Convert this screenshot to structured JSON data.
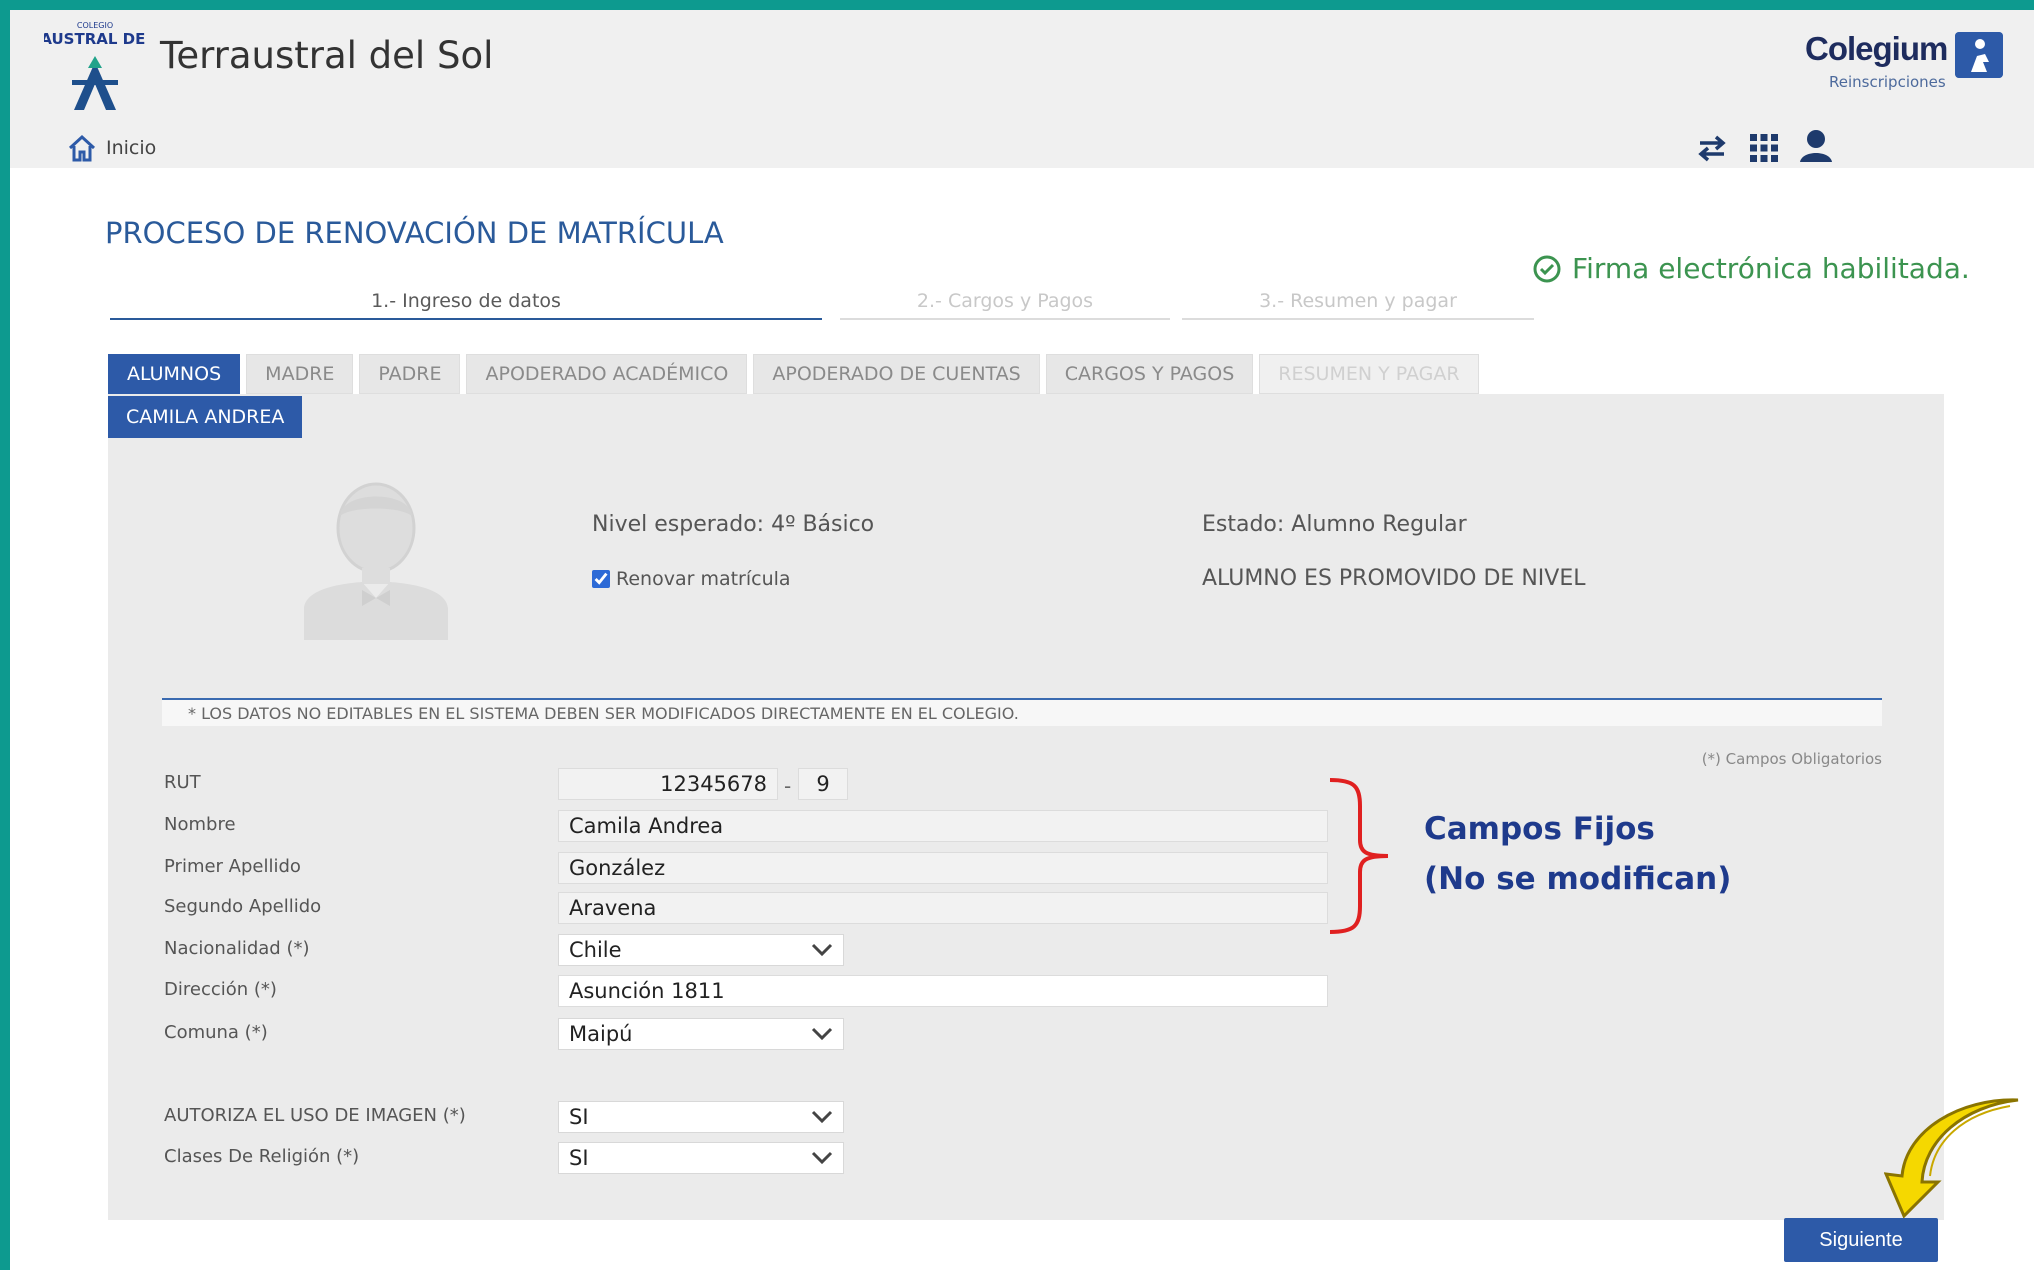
{
  "header": {
    "logo_text": "TERRAUSTRAL DEL SOL",
    "school_name": "Terraustral del Sol",
    "brand_name": "Colegium",
    "brand_sub": "Reinscripciones",
    "home_label": "Inicio"
  },
  "page": {
    "title": "PROCESO DE RENOVACIÓN DE MATRÍCULA",
    "firma": "Firma electrónica habilitada.",
    "steps": [
      "1.- Ingreso de datos",
      "2.- Cargos y Pagos",
      "3.- Resumen y pagar"
    ]
  },
  "tabs": [
    "ALUMNOS",
    "MADRE",
    "PADRE",
    "APODERADO ACADÉMICO",
    "APODERADO DE CUENTAS",
    "CARGOS Y PAGOS",
    "RESUMEN Y PAGAR"
  ],
  "student": {
    "tab": "CAMILA ANDREA",
    "nivel": "Nivel esperado: 4º Básico",
    "estado": "Estado: Alumno Regular",
    "renovar_label": "Renovar matrícula",
    "promovido": "ALUMNO ES PROMOVIDO DE NIVEL"
  },
  "form": {
    "note": "* LOS DATOS NO EDITABLES EN EL SISTEMA DEBEN SER MODIFICADOS DIRECTAMENTE EN EL COLEGIO.",
    "obligatorios": "(*) Campos Obligatorios",
    "rut_label": "RUT",
    "rut_number": "12345678",
    "rut_dash": "-",
    "rut_dv": "9",
    "nombre_label": "Nombre",
    "nombre": "Camila Andrea",
    "apellido1_label": "Primer Apellido",
    "apellido1": "González",
    "apellido2_label": "Segundo Apellido",
    "apellido2": "Aravena",
    "nacionalidad_label": "Nacionalidad (*)",
    "nacionalidad": "Chile",
    "direccion_label": "Dirección (*)",
    "direccion": "Asunción 1811",
    "comuna_label": "Comuna (*)",
    "comuna": "Maipú",
    "imagen_label": "AUTORIZA EL USO DE IMAGEN (*)",
    "imagen": "SI",
    "religion_label": "Clases De Religión (*)",
    "religion": "SI"
  },
  "annotation": {
    "line1": "Campos Fijos",
    "line2": "(No se modifican)"
  },
  "next_label": "Siguiente",
  "colors": {
    "teal_border": "#0d9a8f",
    "primary_blue": "#2d5aa8",
    "brace_red": "#e02020",
    "annotation_blue": "#1e3a8c",
    "arrow_yellow": "#f5d800",
    "firma_green": "#3c9450"
  },
  "icons": [
    "home-icon",
    "switch-icon",
    "apps-grid-icon",
    "user-icon",
    "check-circle-icon",
    "chevron-down-icon",
    "avatar-placeholder-icon"
  ]
}
